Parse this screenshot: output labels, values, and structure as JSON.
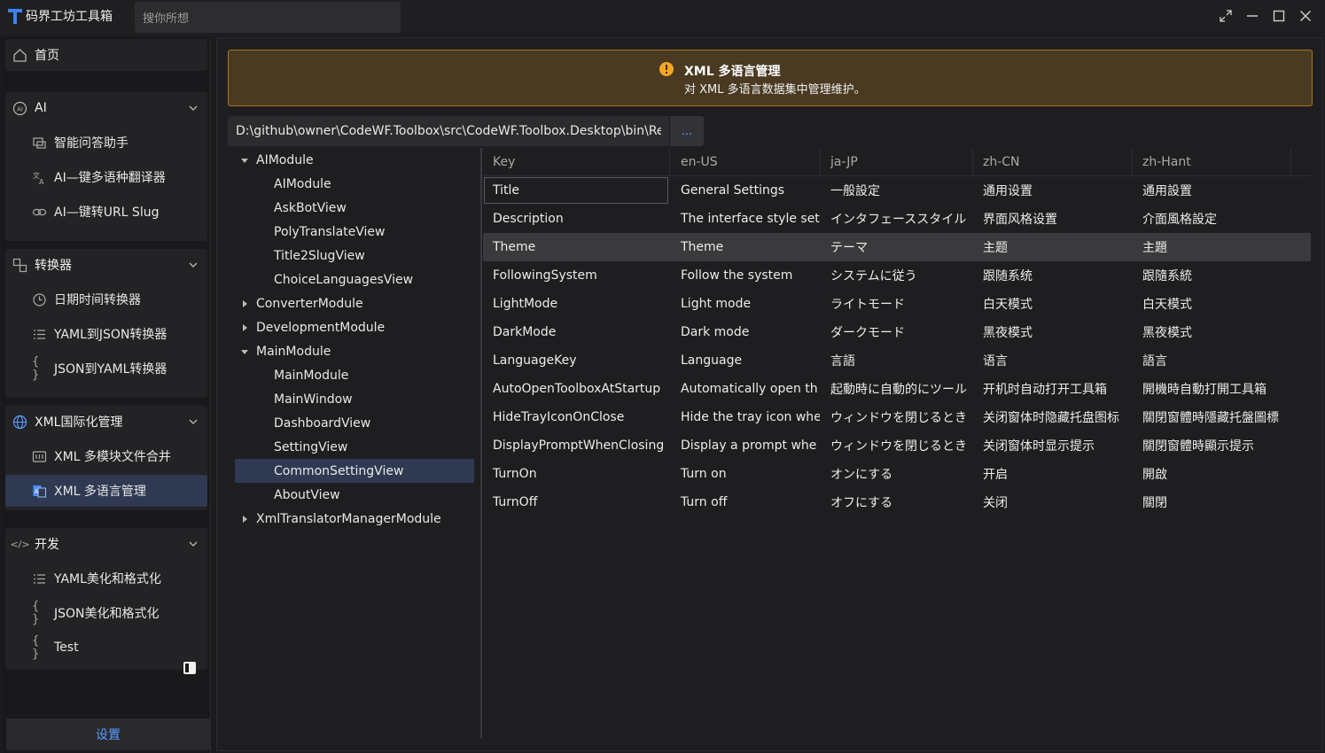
{
  "app": {
    "title": "码界工坊工具箱",
    "search_placeholder": "搜你所想",
    "accent": "#3b82f6"
  },
  "sidebar": {
    "home": "首页",
    "groups": [
      {
        "label": "AI",
        "icon": "ai-circle-icon",
        "items": [
          {
            "label": "智能问答助手",
            "icon": "chat-window-icon"
          },
          {
            "label": "AI—键多语种翻译器",
            "icon": "translate-icon"
          },
          {
            "label": "AI—键转URL Slug",
            "icon": "link-icon"
          }
        ]
      },
      {
        "label": "转换器",
        "icon": "convert-icon",
        "items": [
          {
            "label": "日期时间转换器",
            "icon": "clock-icon"
          },
          {
            "label": "YAML到JSON转换器",
            "icon": "list-icon"
          },
          {
            "label": "JSON到YAML转换器",
            "icon": "braces-icon"
          }
        ]
      },
      {
        "label": "XML国际化管理",
        "icon": "globe-icon",
        "items": [
          {
            "label": "XML 多模块文件合并",
            "icon": "merge-icon"
          },
          {
            "label": "XML 多语言管理",
            "icon": "language-file-icon"
          }
        ]
      },
      {
        "label": "开发",
        "icon": "code-icon",
        "items": [
          {
            "label": "YAML美化和格式化",
            "icon": "list-icon"
          },
          {
            "label": "JSON美化和格式化",
            "icon": "braces-icon"
          },
          {
            "label": "Test",
            "icon": "braces-icon"
          }
        ]
      }
    ],
    "settings": "设置"
  },
  "banner": {
    "title": "XML 多语言管理",
    "description": "对 XML 多语言数据集中管理维护。",
    "color": "#a8731f"
  },
  "path": {
    "value": "D:\\github\\owner\\CodeWF.Toolbox\\src\\CodeWF.Toolbox.Desktop\\bin\\Release",
    "browse_label": "..."
  },
  "tree": [
    {
      "label": "AIModule",
      "level": 0,
      "expanded": true
    },
    {
      "label": "AIModule",
      "level": 1
    },
    {
      "label": "AskBotView",
      "level": 1
    },
    {
      "label": "PolyTranslateView",
      "level": 1
    },
    {
      "label": "Title2SlugView",
      "level": 1
    },
    {
      "label": "ChoiceLanguagesView",
      "level": 1
    },
    {
      "label": "ConverterModule",
      "level": 0,
      "expanded": false
    },
    {
      "label": "DevelopmentModule",
      "level": 0,
      "expanded": false
    },
    {
      "label": "MainModule",
      "level": 0,
      "expanded": true
    },
    {
      "label": "MainModule",
      "level": 1
    },
    {
      "label": "MainWindow",
      "level": 1
    },
    {
      "label": "DashboardView",
      "level": 1
    },
    {
      "label": "SettingView",
      "level": 1
    },
    {
      "label": "CommonSettingView",
      "level": 1,
      "selected": true
    },
    {
      "label": "AboutView",
      "level": 1
    },
    {
      "label": "XmlTranslatorManagerModule",
      "level": 0,
      "expanded": false
    }
  ],
  "grid": {
    "columns": [
      "Key",
      "en-US",
      "ja-JP",
      "zh-CN",
      "zh-Hant"
    ],
    "rows": [
      [
        "Title",
        "General Settings",
        "一般設定",
        "通用设置",
        "通用設置"
      ],
      [
        "Description",
        "The interface style set",
        "インタフェーススタイル",
        "界面风格设置",
        "介面風格設定"
      ],
      [
        "Theme",
        "Theme",
        "テーマ",
        "主题",
        "主題"
      ],
      [
        "FollowingSystem",
        "Follow the system",
        "システムに従う",
        "跟随系统",
        "跟隨系統"
      ],
      [
        "LightMode",
        "Light mode",
        "ライトモード",
        "白天模式",
        "白天模式"
      ],
      [
        "DarkMode",
        "Dark mode",
        "ダークモード",
        "黑夜模式",
        "黑夜模式"
      ],
      [
        "LanguageKey",
        "Language",
        "言語",
        "语言",
        "語言"
      ],
      [
        "AutoOpenToolboxAtStartup",
        "Automatically open th",
        "起動時に自動的にツール",
        "开机时自动打开工具箱",
        "開機時自動打開工具箱"
      ],
      [
        "HideTrayIconOnClose",
        "Hide the tray icon whe",
        "ウィンドウを閉じるとき",
        "关闭窗体时隐藏托盘图标",
        "關閉窗體時隱藏托盤圖標"
      ],
      [
        "DisplayPromptWhenClosing",
        "Display a prompt whe",
        "ウィンドウを閉じるとき",
        "关闭窗体时显示提示",
        "關閉窗體時顯示提示"
      ],
      [
        "TurnOn",
        "Turn on",
        "オンにする",
        "开启",
        "開啟"
      ],
      [
        "TurnOff",
        "Turn off",
        "オフにする",
        "关闭",
        "關閉"
      ]
    ],
    "highlight_row": 2,
    "focus_row": 0
  }
}
